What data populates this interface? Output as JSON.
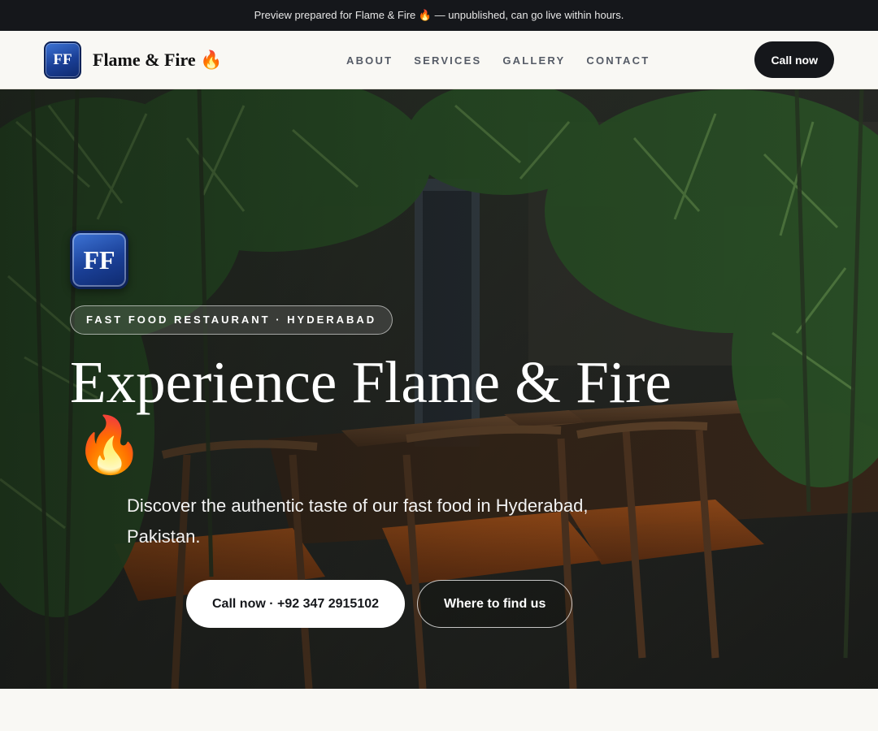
{
  "topbar": {
    "notice": "Preview prepared for Flame & Fire 🔥 — unpublished, can go live within hours."
  },
  "header": {
    "logo_text": "FF",
    "brand_name": "Flame & Fire 🔥",
    "nav": [
      {
        "label": "ABOUT"
      },
      {
        "label": "SERVICES"
      },
      {
        "label": "GALLERY"
      },
      {
        "label": "CONTACT"
      }
    ],
    "cta_label": "Call now"
  },
  "hero": {
    "logo_text": "FF",
    "tag": "FAST FOOD RESTAURANT · HYDERABAD",
    "title": "Experience Flame & Fire",
    "title_emoji": "🔥",
    "subtitle": "Discover the authentic taste of our fast food in Hyderabad, Pakistan.",
    "primary_button": "Call now · +92 347 2915102",
    "secondary_button": "Where to find us"
  },
  "colors": {
    "dark": "#15171b",
    "page_bg": "#f9f8f4",
    "logo_blue": "#1a3f96"
  }
}
